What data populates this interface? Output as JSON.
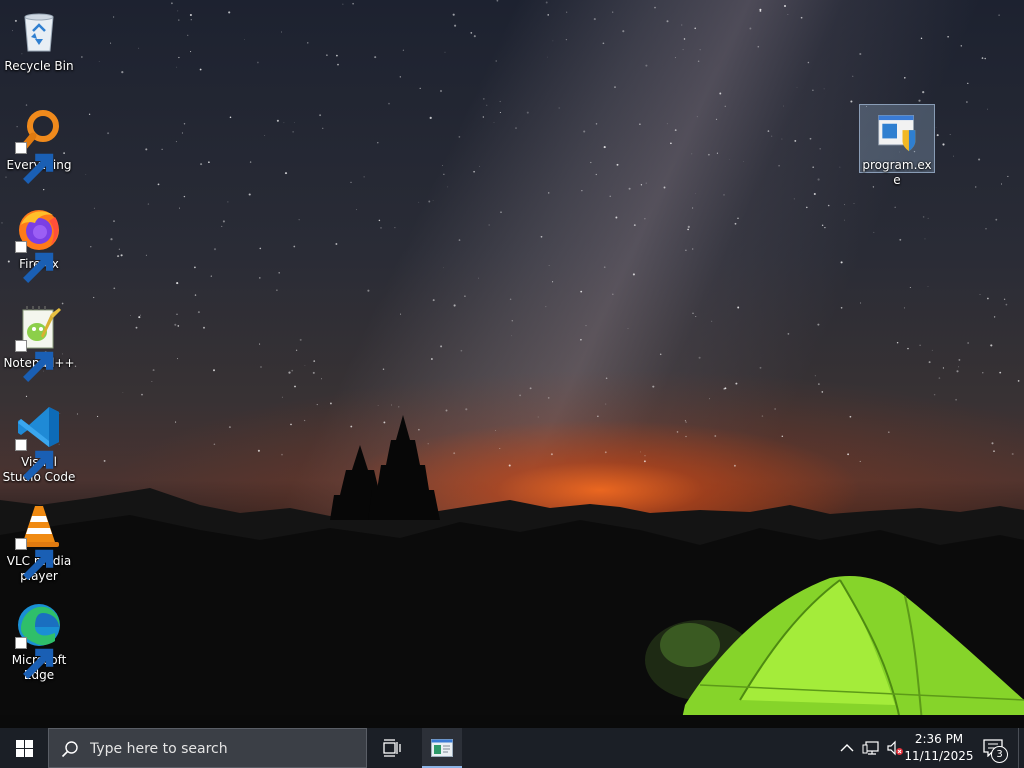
{
  "desktop": {
    "icons": [
      {
        "label": "Recycle Bin",
        "icon": "recycle-bin-icon",
        "shortcut": false
      },
      {
        "label": "Everything",
        "icon": "everything-search-icon",
        "shortcut": true
      },
      {
        "label": "Firefox",
        "icon": "firefox-icon",
        "shortcut": true
      },
      {
        "label": "Notepad++",
        "icon": "notepad-plus-plus-icon",
        "shortcut": true
      },
      {
        "label": "Visual Studio Code",
        "icon": "vscode-icon",
        "shortcut": true
      },
      {
        "label": "VLC media player",
        "icon": "vlc-icon",
        "shortcut": true
      },
      {
        "label": "Microsoft Edge",
        "icon": "edge-icon",
        "shortcut": true
      },
      {
        "label": "program.exe",
        "icon": "program-exe-icon",
        "shortcut": false,
        "selected": true
      }
    ]
  },
  "taskbar": {
    "start_icon": "windows-logo-icon",
    "search": {
      "placeholder": "Type here to search",
      "value": ""
    },
    "task_view_icon": "task-view-icon",
    "pinned_apps": [
      {
        "name": "program-window",
        "icon": "app-window-icon",
        "active": true
      }
    ],
    "tray": {
      "chevron_icon": "chevron-up-icon",
      "network_icon": "network-icon",
      "volume_icon": "volume-muted-icon"
    },
    "clock": {
      "time": "2:36 PM",
      "date": "11/11/2025"
    },
    "notifications": {
      "icon": "action-center-icon",
      "count": "3"
    }
  }
}
